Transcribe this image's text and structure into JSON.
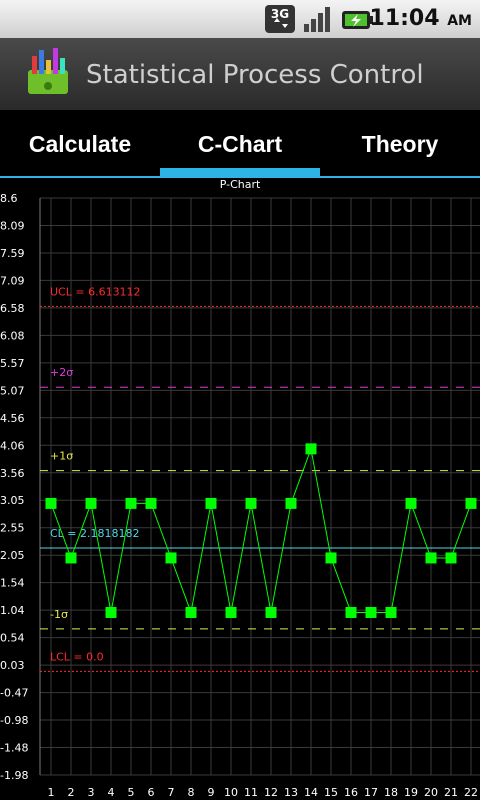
{
  "status_bar": {
    "network": "3G",
    "time": "11:04",
    "ampm": "AM"
  },
  "app": {
    "title": "Statistical Process Control"
  },
  "tabs": [
    {
      "label": "Calculate",
      "selected": false
    },
    {
      "label": "C-Chart",
      "selected": true
    },
    {
      "label": "Theory",
      "selected": false
    }
  ],
  "colors": {
    "accent": "#2db3e6",
    "points": "#00ff00",
    "ucl_lcl": "#ff2b2b",
    "sigma2": "#e23be2",
    "sigma1": "#e8e84a",
    "cl": "#4fd6e6"
  },
  "chart_data": {
    "type": "line",
    "title": "P-Chart",
    "y_ticks": [
      "8.6",
      "8.09",
      "7.59",
      "7.09",
      "6.58",
      "6.08",
      "5.57",
      "5.07",
      "4.56",
      "4.06",
      "3.56",
      "3.05",
      "2.55",
      "2.05",
      "1.54",
      "1.04",
      "0.54",
      "0.03",
      "-0.47",
      "-0.98",
      "-1.48",
      "-1.98"
    ],
    "ylim": [
      -1.98,
      8.6
    ],
    "x_ticks": [
      "1",
      "2",
      "3",
      "4",
      "5",
      "6",
      "7",
      "8",
      "9",
      "10",
      "11",
      "12",
      "13",
      "14",
      "15",
      "16",
      "17",
      "18",
      "19",
      "20",
      "21",
      "22"
    ],
    "x": [
      1,
      2,
      3,
      4,
      5,
      6,
      7,
      8,
      9,
      10,
      11,
      12,
      13,
      14,
      15,
      16,
      17,
      18,
      19,
      20,
      21,
      22
    ],
    "values": [
      3,
      2,
      3,
      1,
      3,
      3,
      2,
      1,
      3,
      1,
      3,
      1,
      3,
      4,
      2,
      1,
      1,
      1,
      3,
      2,
      2,
      3
    ],
    "control_lines": [
      {
        "label": "UCL = 6.613112",
        "value": 6.613112,
        "color": "#ff2b2b",
        "style": "dotted"
      },
      {
        "label": "+2σ",
        "value": 5.13,
        "color": "#e23be2",
        "style": "dashed"
      },
      {
        "label": "+1σ",
        "value": 3.6,
        "color": "#e8e84a",
        "style": "dashed"
      },
      {
        "label": "CL = 2.1818182",
        "value": 2.1818182,
        "color": "#4fd6e6",
        "style": "solid"
      },
      {
        "label": "-1σ",
        "value": 0.7,
        "color": "#e8e84a",
        "style": "dashed"
      },
      {
        "label": "LCL = 0.0",
        "value": -0.08,
        "color": "#ff2b2b",
        "style": "dotted"
      }
    ],
    "grid": true
  }
}
